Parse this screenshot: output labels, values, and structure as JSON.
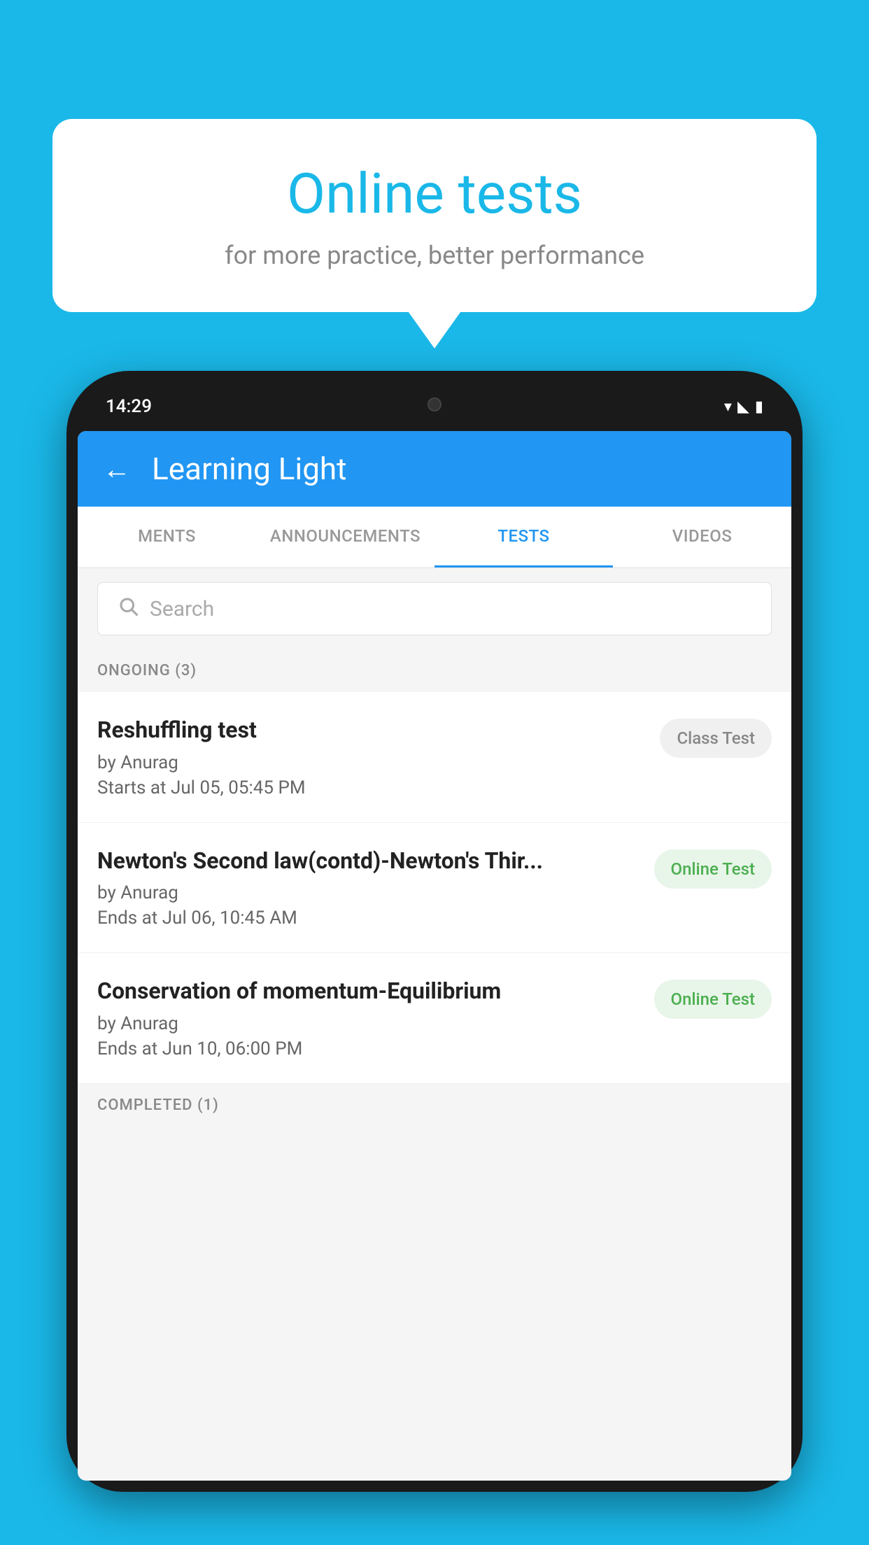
{
  "background_color": "#1ab8e8",
  "bubble": {
    "title": "Online tests",
    "subtitle": "for more practice, better performance"
  },
  "phone": {
    "time": "14:29",
    "app_title": "Learning Light",
    "back_label": "←"
  },
  "tabs": [
    {
      "label": "MENTS",
      "active": false
    },
    {
      "label": "ANNOUNCEMENTS",
      "active": false
    },
    {
      "label": "TESTS",
      "active": true
    },
    {
      "label": "VIDEOS",
      "active": false
    }
  ],
  "search": {
    "placeholder": "Search"
  },
  "ongoing": {
    "header": "ONGOING (3)",
    "items": [
      {
        "name": "Reshuffling test",
        "author": "by Anurag",
        "date": "Starts at  Jul 05, 05:45 PM",
        "badge": "Class Test",
        "badge_type": "class"
      },
      {
        "name": "Newton's Second law(contd)-Newton's Thir...",
        "author": "by Anurag",
        "date": "Ends at  Jul 06, 10:45 AM",
        "badge": "Online Test",
        "badge_type": "online"
      },
      {
        "name": "Conservation of momentum-Equilibrium",
        "author": "by Anurag",
        "date": "Ends at  Jun 10, 06:00 PM",
        "badge": "Online Test",
        "badge_type": "online"
      }
    ]
  },
  "completed": {
    "header": "COMPLETED (1)"
  }
}
